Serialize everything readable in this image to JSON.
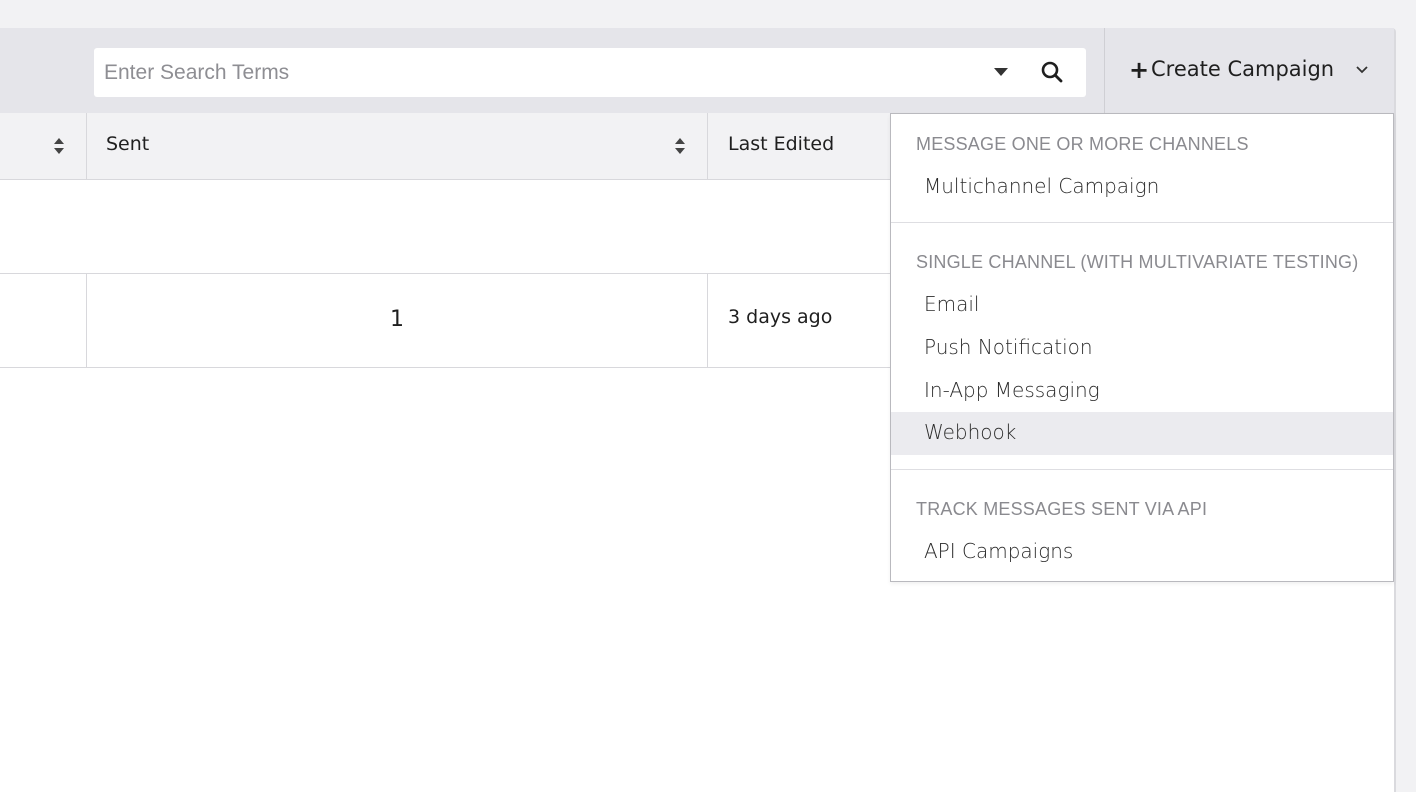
{
  "search": {
    "placeholder": "Enter Search Terms"
  },
  "toolbar": {
    "create_label": "Create Campaign"
  },
  "table": {
    "columns": [
      "Sent",
      "Last Edited"
    ],
    "rows": [
      {
        "sent": "",
        "last_edited": ""
      },
      {
        "sent": "1",
        "last_edited": "3 days ago"
      }
    ]
  },
  "menu": {
    "sections": [
      {
        "heading": "MESSAGE ONE OR MORE CHANNELS",
        "items": [
          "Multichannel Campaign"
        ]
      },
      {
        "heading": "SINGLE CHANNEL (WITH MULTIVARIATE TESTING)",
        "items": [
          "Email",
          "Push Notification",
          "In-App Messaging",
          "Webhook"
        ]
      },
      {
        "heading": "TRACK MESSAGES SENT VIA API",
        "items": [
          "API Campaigns"
        ]
      }
    ],
    "highlighted_item": "Webhook"
  },
  "icons": {
    "search": "search-icon",
    "caret": "caret-down-icon",
    "plus": "plus-icon",
    "chevron": "chevron-down-icon",
    "sort": "sort-icon"
  }
}
